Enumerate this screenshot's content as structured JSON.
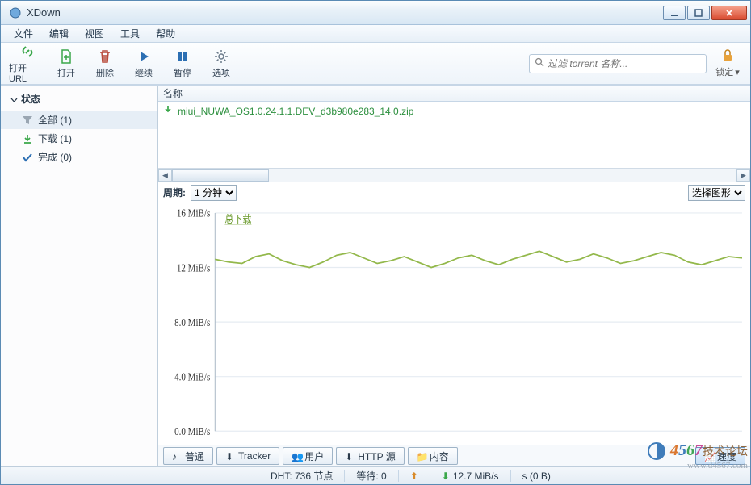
{
  "window": {
    "title": "XDown"
  },
  "menubar": {
    "items": [
      "文件",
      "编辑",
      "视图",
      "工具",
      "帮助"
    ]
  },
  "toolbar": {
    "open_url": "打开 URL",
    "open": "打开",
    "delete": "删除",
    "resume": "继续",
    "pause": "暂停",
    "options": "选项",
    "search_placeholder": "过滤 torrent 名称...",
    "lock_label": "锁定"
  },
  "sidebar": {
    "header": "状态",
    "items": [
      {
        "label": "全部 (1)",
        "icon": "filter",
        "selected": true
      },
      {
        "label": "下载 (1)",
        "icon": "down",
        "selected": false
      },
      {
        "label": "完成 (0)",
        "icon": "check",
        "selected": false
      }
    ]
  },
  "list": {
    "column": "名称",
    "rows": [
      {
        "name": "miui_NUWA_OS1.0.24.1.1.DEV_d3b980e283_14.0.zip"
      }
    ]
  },
  "period": {
    "label": "周期:",
    "value": "1 分钟",
    "chart_select": "选择图形"
  },
  "tabs": {
    "general": "普通",
    "trackers": "Tracker",
    "peers": "用户",
    "http": "HTTP 源",
    "content": "内容",
    "speed": "速度"
  },
  "statusbar": {
    "dht": "DHT: 736 节点",
    "waiting": "等待: 0",
    "up_speed": "s (0 B)",
    "down_speed": "12.7 MiB/s"
  },
  "watermark": {
    "brand_digits": "4567",
    "brand_zh": "技术论坛",
    "url": "www.d4567.com"
  },
  "chart_data": {
    "type": "line",
    "title": "",
    "legend": "总下载",
    "xlabel": "",
    "ylabel": "",
    "y_ticks": [
      "0.0 MiB/s",
      "4.0 MiB/s",
      "8.0 MiB/s",
      "12 MiB/s",
      "16 MiB/s"
    ],
    "ylim": [
      0,
      16
    ],
    "x": [
      0,
      1,
      2,
      3,
      4,
      5,
      6,
      7,
      8,
      9,
      10,
      11,
      12,
      13,
      14,
      15,
      16,
      17,
      18,
      19,
      20,
      21,
      22,
      23,
      24,
      25,
      26,
      27,
      28,
      29,
      30,
      31,
      32,
      33,
      34,
      35,
      36,
      37,
      38,
      39
    ],
    "series": [
      {
        "name": "总下载",
        "color": "#93b84b",
        "values": [
          12.6,
          12.4,
          12.3,
          12.8,
          13.0,
          12.5,
          12.2,
          12.0,
          12.4,
          12.9,
          13.1,
          12.7,
          12.3,
          12.5,
          12.8,
          12.4,
          12.0,
          12.3,
          12.7,
          12.9,
          12.5,
          12.2,
          12.6,
          12.9,
          13.2,
          12.8,
          12.4,
          12.6,
          13.0,
          12.7,
          12.3,
          12.5,
          12.8,
          13.1,
          12.9,
          12.4,
          12.2,
          12.5,
          12.8,
          12.7
        ]
      }
    ]
  }
}
